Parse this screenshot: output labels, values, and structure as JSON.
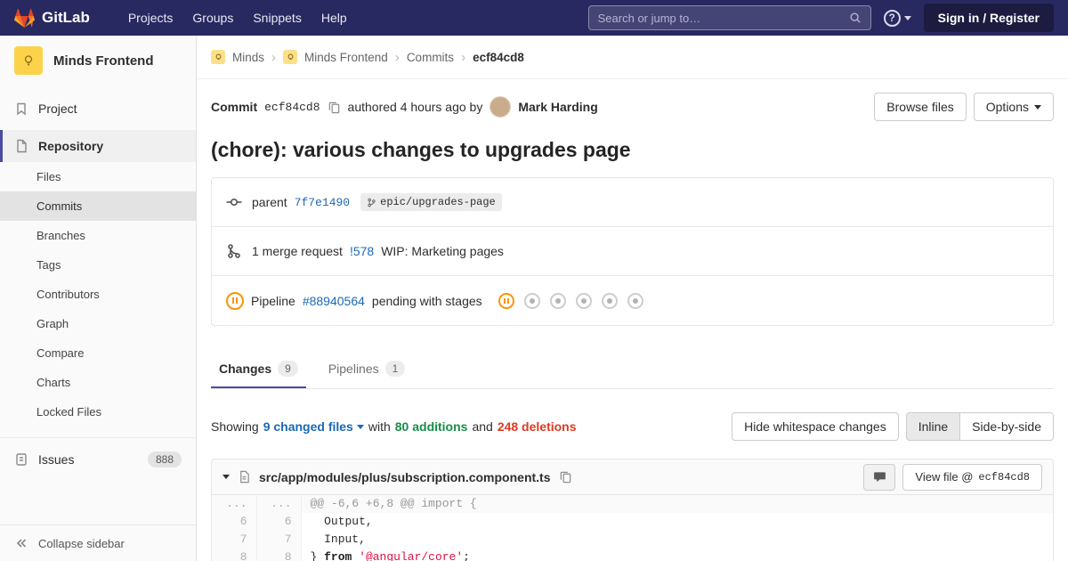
{
  "colors": {
    "navbar_bg": "#292961",
    "accent": "#4b4ba3",
    "link_blue": "#1b69b6",
    "addition_green": "#168f48",
    "deletion_red": "#db3b21",
    "pending_orange": "#fc9403",
    "string_red": "#dd1144"
  },
  "navbar": {
    "brand": "GitLab",
    "menu": [
      "Projects",
      "Groups",
      "Snippets",
      "Help"
    ],
    "search_placeholder": "Search or jump to…",
    "sign_in_label": "Sign in / Register"
  },
  "sidebar": {
    "project_name": "Minds Frontend",
    "project_item": "Project",
    "repository_item": "Repository",
    "repo_items": [
      "Files",
      "Commits",
      "Branches",
      "Tags",
      "Contributors",
      "Graph",
      "Compare",
      "Charts",
      "Locked Files"
    ],
    "issues_label": "Issues",
    "issues_count": "888",
    "collapse_label": "Collapse sidebar"
  },
  "breadcrumb": {
    "items": [
      "Minds",
      "Minds Frontend",
      "Commits"
    ],
    "current": "ecf84cd8"
  },
  "commit": {
    "label": "Commit",
    "sha": "ecf84cd8",
    "authored_text": "authored 4 hours ago by",
    "author": "Mark Harding",
    "browse_files_label": "Browse files",
    "options_label": "Options",
    "title": "(chore): various changes to upgrades page",
    "parent_label": "parent",
    "parent_sha": "7f7e1490",
    "branch_ref": "epic/upgrades-page",
    "mr_count_text": "1 merge request",
    "mr_ref": "!578",
    "mr_title": "WIP: Marketing pages",
    "pipeline_label": "Pipeline",
    "pipeline_id": "#88940564",
    "pipeline_status_text": "pending with stages",
    "stages": [
      "pending",
      "created",
      "created",
      "created",
      "created",
      "created"
    ]
  },
  "tabs": {
    "changes_label": "Changes",
    "changes_badge": "9",
    "pipelines_label": "Pipelines",
    "pipelines_badge": "1"
  },
  "diff_meta": {
    "showing": "Showing",
    "changed_files": "9 changed files",
    "with_text": "with",
    "additions": "80 additions",
    "and_text": "and",
    "deletions": "248 deletions",
    "hide_whitespace_label": "Hide whitespace changes",
    "inline_label": "Inline",
    "side_by_side_label": "Side-by-side"
  },
  "diff_file": {
    "path": "src/app/modules/plus/subscription.component.ts",
    "view_file_label": "View file @",
    "view_file_sha": "ecf84cd8",
    "hunk_ln": "...",
    "hunk_header": "@@ -6,6 +6,8 @@ import {",
    "lines": [
      {
        "old": "6",
        "new": "6",
        "code": "  Output,"
      },
      {
        "old": "7",
        "new": "7",
        "code": "  Input,"
      },
      {
        "old": "8",
        "new": "8",
        "code_pre": "} ",
        "code_kw": "from",
        "code_mid": " ",
        "code_str": "'@angular/core'",
        "code_end": ";"
      }
    ]
  }
}
